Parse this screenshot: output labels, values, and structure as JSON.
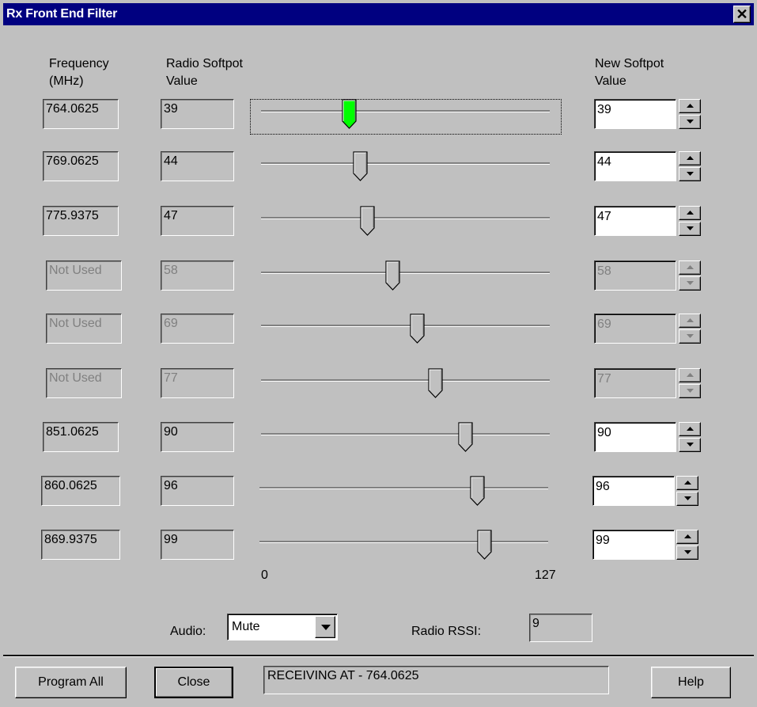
{
  "window": {
    "title": "Rx Front End Filter",
    "close_glyph": "✕"
  },
  "headers": {
    "frequency": [
      "Frequency",
      "(MHz)"
    ],
    "radio_softpot": [
      "Radio Softpot",
      "Value"
    ],
    "new_softpot": [
      "New Softpot",
      "Value"
    ]
  },
  "rows": [
    {
      "frequency": "764.0625",
      "radio_value": "39",
      "slider_value": 39,
      "new_value": "39",
      "enabled": true,
      "focused": true
    },
    {
      "frequency": "769.0625",
      "radio_value": "44",
      "slider_value": 44,
      "new_value": "44",
      "enabled": true,
      "focused": false
    },
    {
      "frequency": "775.9375",
      "radio_value": "47",
      "slider_value": 47,
      "new_value": "47",
      "enabled": true,
      "focused": false
    },
    {
      "frequency": "Not Used",
      "radio_value": "58",
      "slider_value": 58,
      "new_value": "58",
      "enabled": false,
      "focused": false
    },
    {
      "frequency": "Not Used",
      "radio_value": "69",
      "slider_value": 69,
      "new_value": "69",
      "enabled": false,
      "focused": false
    },
    {
      "frequency": "Not Used",
      "radio_value": "77",
      "slider_value": 77,
      "new_value": "77",
      "enabled": false,
      "focused": false
    },
    {
      "frequency": "851.0625",
      "radio_value": "90",
      "slider_value": 90,
      "new_value": "90",
      "enabled": true,
      "focused": false
    },
    {
      "frequency": "860.0625",
      "radio_value": "96",
      "slider_value": 96,
      "new_value": "96",
      "enabled": true,
      "focused": false
    },
    {
      "frequency": "869.9375",
      "radio_value": "99",
      "slider_value": 99,
      "new_value": "99",
      "enabled": true,
      "focused": false
    }
  ],
  "scale": {
    "min_label": "0",
    "max_label": "127",
    "min": 0,
    "max": 127
  },
  "audio": {
    "label": "Audio:",
    "value": "Mute"
  },
  "rssi": {
    "label": "Radio RSSI:",
    "value": "9"
  },
  "buttons": {
    "program_all": "Program All",
    "close": "Close",
    "help": "Help"
  },
  "status": {
    "text": "RECEIVING AT - 764.0625"
  },
  "colors": {
    "titlebar": "#000080",
    "face": "#c0c0c0",
    "thumb_active": "#00ff00",
    "disabled_text": "#808080"
  }
}
